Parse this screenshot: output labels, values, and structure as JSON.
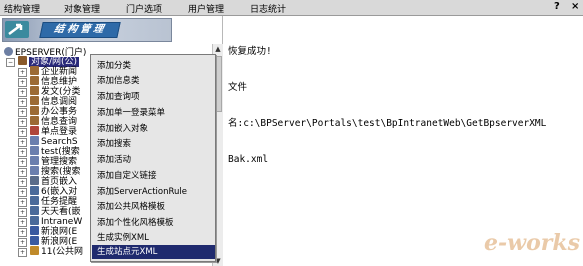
{
  "menu": {
    "items": [
      "结构管理",
      "对象管理",
      "门户选项",
      "用户管理",
      "日志统计"
    ],
    "help": "?",
    "close": "×"
  },
  "banner": {
    "title": "结构管理"
  },
  "tree": {
    "root": "EPSERVER(门户)",
    "nodes": [
      {
        "label": "对象/网(公)",
        "selected": true
      },
      {
        "label": "企业新闻"
      },
      {
        "label": "信息维护"
      },
      {
        "label": "发文(分类"
      },
      {
        "label": "信息调阅"
      },
      {
        "label": "办公事务"
      },
      {
        "label": "信息查询"
      },
      {
        "label": "单点登录"
      },
      {
        "label": "SearchS"
      },
      {
        "label": "test(搜索"
      },
      {
        "label": "管理搜索"
      },
      {
        "label": "搜索(搜索"
      },
      {
        "label": "首页嵌入"
      },
      {
        "label": "6(嵌入对"
      },
      {
        "label": "任务提醒"
      },
      {
        "label": "天天看(嵌"
      },
      {
        "label": "IntraneW"
      },
      {
        "label": "新浪网(E"
      },
      {
        "label": "新浪网(E"
      },
      {
        "label": "11(公共网"
      }
    ]
  },
  "context_menu": {
    "items": [
      "添加分类",
      "添加信息类",
      "添加查询项",
      "添加单一登录菜单",
      "添加嵌入对象",
      "添加搜索",
      "添加活动",
      "添加自定义链接",
      "添加ServerActionRule",
      "添加公共风格模板",
      "添加个性化风格模板",
      "生成实例XML",
      "生成站点元XML"
    ],
    "selected_index": 12
  },
  "output": {
    "line1": "恢复成功!",
    "line2": "文件",
    "line3": "名:c:\\BPServer\\Portals\\test\\BpIntranetWeb\\GetBpserverXML",
    "line4": "Bak.xml"
  },
  "watermark": "e-works",
  "colors": {
    "menu_selected": "#1f2a6e",
    "tree_selected": "#2a2a7a",
    "banner_title": "#2e6aa8"
  }
}
